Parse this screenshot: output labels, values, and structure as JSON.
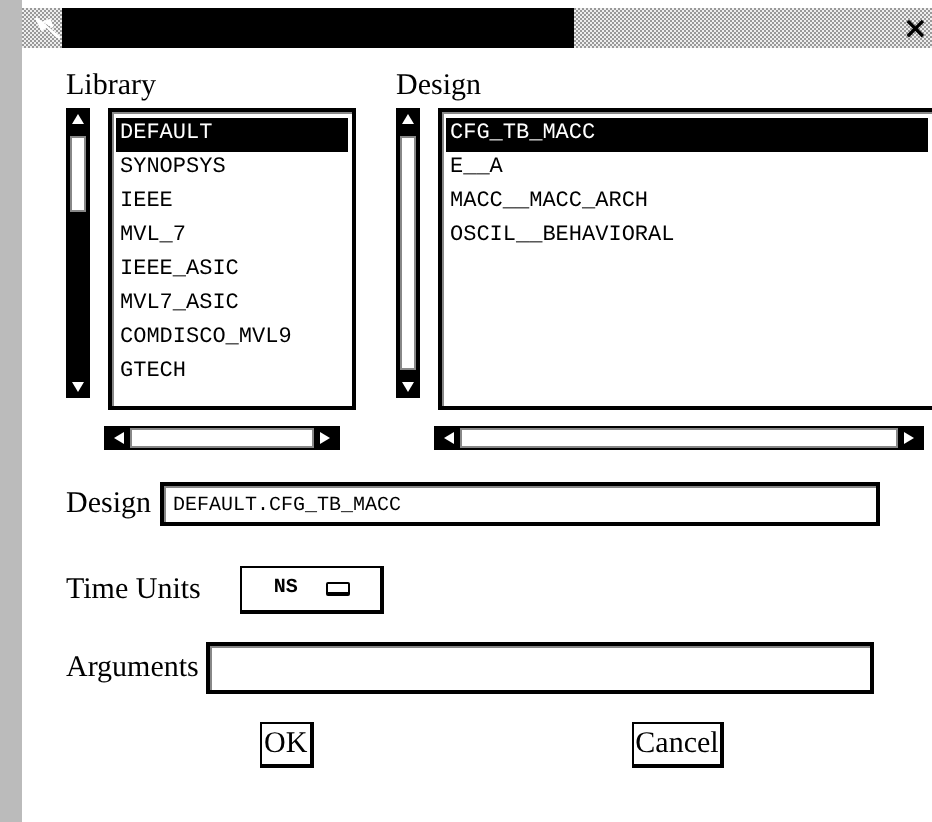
{
  "window": {
    "close_glyph": "×"
  },
  "library": {
    "label": "Library",
    "items": [
      {
        "text": "DEFAULT",
        "selected": true
      },
      {
        "text": "SYNOPSYS",
        "selected": false
      },
      {
        "text": "IEEE",
        "selected": false
      },
      {
        "text": "MVL_7",
        "selected": false
      },
      {
        "text": "IEEE_ASIC",
        "selected": false
      },
      {
        "text": "MVL7_ASIC",
        "selected": false
      },
      {
        "text": "COMDISCO_MVL9",
        "selected": false
      },
      {
        "text": "GTECH",
        "selected": false
      }
    ]
  },
  "design_list": {
    "label": "Design",
    "items": [
      {
        "text": "CFG_TB_MACC",
        "selected": true
      },
      {
        "text": "E__A",
        "selected": false
      },
      {
        "text": "MACC__MACC_ARCH",
        "selected": false
      },
      {
        "text": "OSCIL__BEHAVIORAL",
        "selected": false
      }
    ]
  },
  "design_field": {
    "label": "Design",
    "value": "DEFAULT.CFG_TB_MACC"
  },
  "time_units": {
    "label": "Time Units",
    "value": "NS"
  },
  "arguments": {
    "label": "Arguments"
  },
  "buttons": [
    {
      "label": "OK"
    },
    {
      "label": "Cancel"
    }
  ]
}
